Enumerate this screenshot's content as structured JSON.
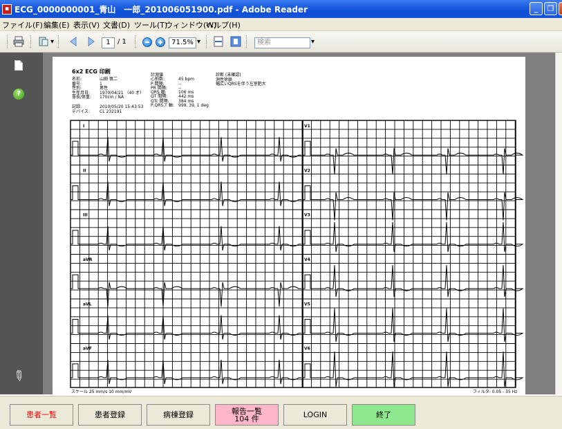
{
  "window": {
    "title": "ECG_0000000001_青山　一郎_201006051900.pdf - Adobe Reader",
    "app_icon": "adobe-reader-icon"
  },
  "menu": [
    "ファイル(F)",
    "編集(E)",
    "表示(V)",
    "文書(D)",
    "ツール(T)",
    "ウィンドウ(W)",
    "ヘルプ(H)"
  ],
  "toolbar": {
    "page_current": "1",
    "page_total": "/ 1",
    "zoom": "71.5%",
    "search_placeholder": "検索",
    "dropdown_arrow": "▾"
  },
  "report": {
    "title": "6x2 ECG 印刷",
    "patient_labels": [
      "名前:",
      "番号:",
      "性別:",
      "生年月日:",
      "身長/体重:"
    ],
    "patient_values": [
      "山田 慎二",
      "1",
      "男性",
      "1970/04/21 （40 才）",
      "170cm / NA"
    ],
    "record_labels": [
      "記録:",
      "デバイス:"
    ],
    "record_values": [
      "2010/05/20 15:43:53",
      "CL 232191"
    ],
    "measure_title": "計測値",
    "measure_labels": [
      "心拍数:",
      "P 間隔:",
      "PR 間隔:",
      "QRS 幅:",
      "QT 間隔:",
      "QTc 間隔:",
      "P,QRS,T 軸:"
    ],
    "measure_values": [
      "45 bpm",
      "--",
      "--",
      "106 ms",
      "442 ms",
      "384 ms",
      "999, 39, 1 deg"
    ],
    "diagnosis_title": "診断 (未確認)",
    "diagnosis_lines": [
      "洞性徐脈",
      "幅広いQRSを伴う左室肥大"
    ],
    "leads_left": [
      "I",
      "II",
      "III",
      "aVR",
      "aVL",
      "aVF"
    ],
    "leads_right": [
      "V1",
      "V2",
      "V3",
      "V4",
      "V5",
      "V6"
    ],
    "footer_scale": "スケール 25 mm/s  10 mm/mV",
    "footer_filter": "フィルタ: 0.05 - 35 Hz"
  },
  "bottom_buttons": [
    {
      "label": "患者一覧",
      "sub": "",
      "color": "#ff0000",
      "bg": "#ece9d8"
    },
    {
      "label": "患者登録",
      "sub": "",
      "color": "#000000",
      "bg": "#ece9d8"
    },
    {
      "label": "病棟登録",
      "sub": "",
      "color": "#000000",
      "bg": "#ece9d8"
    },
    {
      "label": "報告一覧",
      "sub": "104 件",
      "color": "#000000",
      "bg": "#ffb6c8"
    },
    {
      "label": "LOGIN",
      "sub": "",
      "color": "#000000",
      "bg": "#ece9d8"
    },
    {
      "label": "終了",
      "sub": "",
      "color": "#000000",
      "bg": "#8ee88e"
    }
  ],
  "colors": {
    "titlebar": "#0d4fd6",
    "panel": "#545454",
    "docbg": "#7f7f7f"
  }
}
